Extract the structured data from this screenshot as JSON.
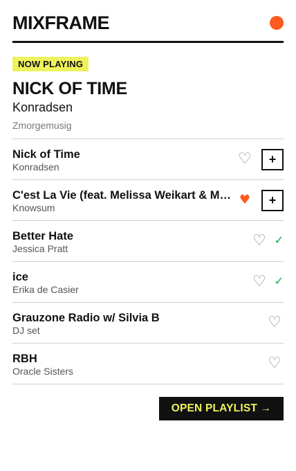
{
  "header": {
    "brand": "MIXFRAME"
  },
  "now_playing": {
    "badge": "NOW PLAYING",
    "title": "NICK OF TIME",
    "artist": "Konradsen",
    "label": "Zmorgemusig"
  },
  "icons": {
    "heart": "♡",
    "heart_liked": "♥",
    "add": "+",
    "check": "✓",
    "live_dot": "live-indicator-dot"
  },
  "colors": {
    "accent": "#ff5a1f",
    "highlight": "#eef35c",
    "check": "#1ba34b",
    "text": "#111111"
  },
  "tracks": [
    {
      "title": "Nick of Time",
      "artist": "Konradsen",
      "liked": false,
      "action": "add"
    },
    {
      "title": "C'est La Vie (feat. Melissa Weikart & Mad…",
      "artist": "Knowsum",
      "liked": true,
      "action": "add"
    },
    {
      "title": "Better Hate",
      "artist": "Jessica Pratt",
      "liked": false,
      "action": "added"
    },
    {
      "title": "ice",
      "artist": "Erika de Casier",
      "liked": false,
      "action": "added"
    },
    {
      "title": "Grauzone Radio w/ Silvia B",
      "artist": "DJ set",
      "liked": false,
      "action": "none"
    },
    {
      "title": "RBH",
      "artist": "Oracle Sisters",
      "liked": false,
      "action": "none"
    }
  ],
  "footer": {
    "open_playlist": "OPEN PLAYLIST →"
  }
}
